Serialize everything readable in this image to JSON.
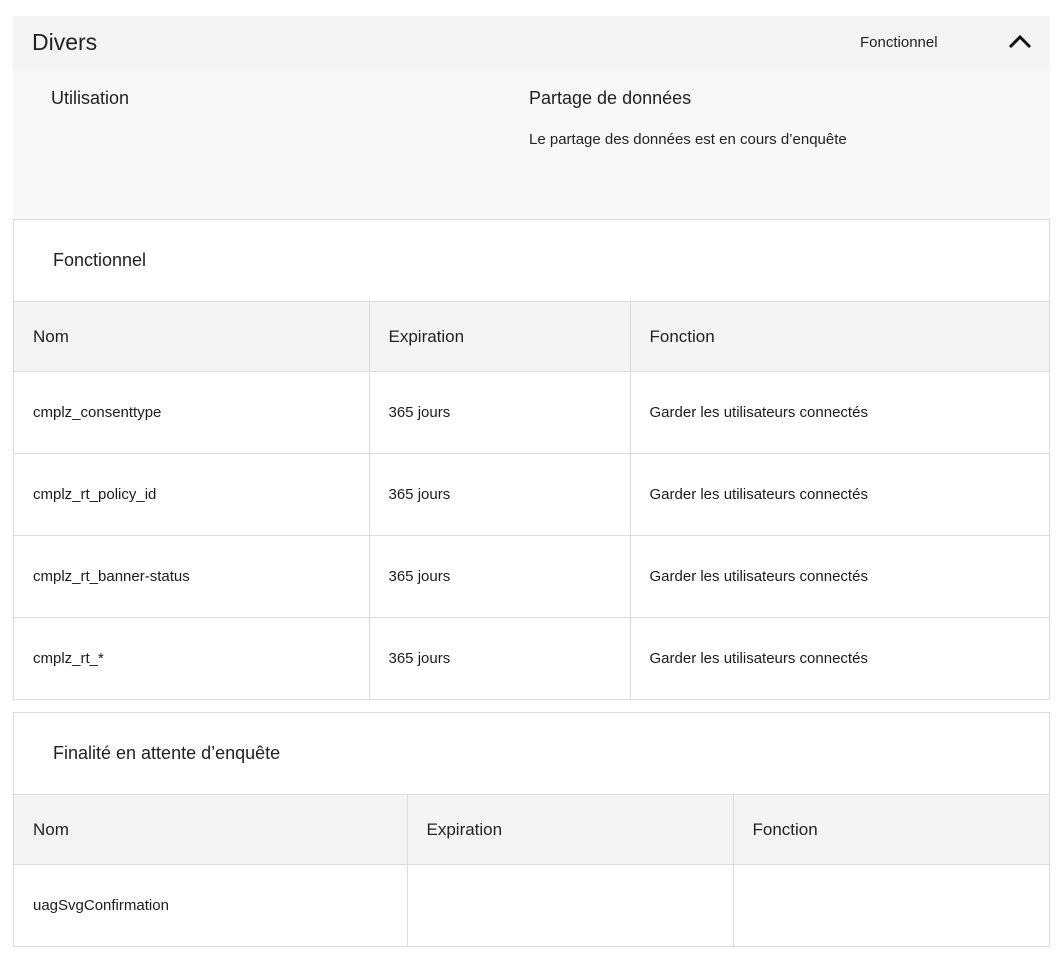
{
  "section": {
    "title": "Divers",
    "status": "Fonctionnel",
    "usage_title": "Utilisation",
    "sharing_title": "Partage de données",
    "sharing_text": "Le partage des données est en cours d’enquête"
  },
  "functional": {
    "title": "Fonctionnel",
    "headers": [
      "Nom",
      "Expiration",
      "Fonction"
    ],
    "rows": [
      [
        "cmplz_consenttype",
        "365 jours",
        "Garder les utilisateurs connectés"
      ],
      [
        "cmplz_rt_policy_id",
        "365 jours",
        "Garder les utilisateurs connectés"
      ],
      [
        "cmplz_rt_banner-status",
        "365 jours",
        "Garder les utilisateurs connectés"
      ],
      [
        "cmplz_rt_*",
        "365 jours",
        "Garder les utilisateurs connectés"
      ]
    ]
  },
  "pending": {
    "title": "Finalité en attente d’enquête",
    "headers": [
      "Nom",
      "Expiration",
      "Fonction"
    ],
    "rows": [
      [
        "uagSvgConfirmation",
        "",
        ""
      ]
    ]
  },
  "icons": {
    "collapse": "chevron-up-icon"
  },
  "colors": {
    "header_bg": "#f4f4f4",
    "panel_bg": "#f8f8f8",
    "border": "#dcdcdc"
  }
}
